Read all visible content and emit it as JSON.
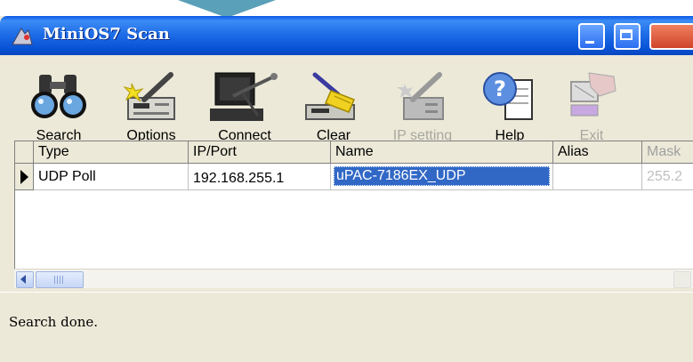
{
  "window": {
    "title": "MiniOS7 Scan"
  },
  "toolbar": {
    "buttons": [
      {
        "label": "Search",
        "accel": "S",
        "rest": "earch",
        "icon": "binoculars-icon",
        "enabled": true
      },
      {
        "label": "Options",
        "accel": "O",
        "rest": "ptions",
        "icon": "options-icon",
        "enabled": true
      },
      {
        "label": "Connect",
        "accel": "C",
        "rest": "onnect",
        "icon": "computer-connect-icon",
        "enabled": true
      },
      {
        "label": "Clear",
        "pre": "Clea",
        "accel": "r",
        "icon": "broom-icon",
        "enabled": true
      },
      {
        "label": "IP setting",
        "icon": "ip-setting-icon",
        "enabled": false
      },
      {
        "label": "Help",
        "accel": "H",
        "rest": "elp",
        "icon": "help-icon",
        "enabled": true
      },
      {
        "label": "Exit",
        "pre": "E",
        "accel": "x",
        "rest": "it",
        "icon": "exit-icon",
        "enabled": false
      }
    ]
  },
  "grid": {
    "columns": [
      "Type",
      "IP/Port",
      "Name",
      "Alias",
      "Mask"
    ],
    "rows": [
      {
        "type": "UDP Poll",
        "ip": "192.168.255.1",
        "name": "uPAC-7186EX_UDP",
        "alias": "",
        "mask": "255.2"
      }
    ]
  },
  "status": {
    "text": "Search done."
  },
  "colors": {
    "titlebar": "#0a55d8",
    "selection": "#3168c6",
    "face": "#ece9d8"
  }
}
